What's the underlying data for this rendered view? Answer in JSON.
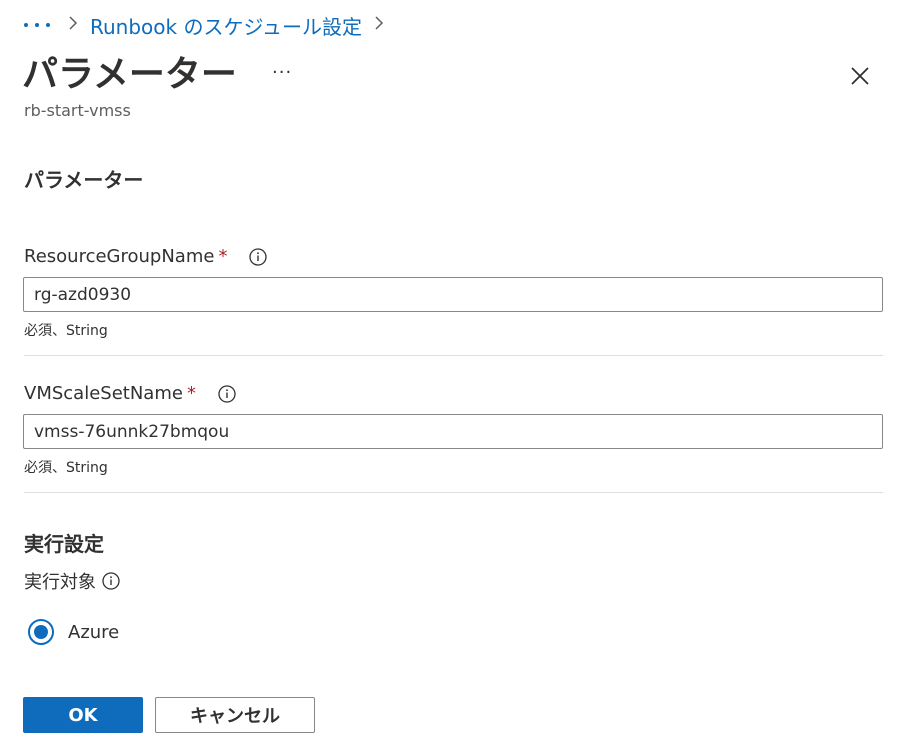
{
  "breadcrumb": {
    "items": [
      "Runbook のスケジュール設定"
    ]
  },
  "header": {
    "title": "パラメーター",
    "more_label": "···",
    "subtitle": "rb-start-vmss"
  },
  "parameters_section": {
    "heading": "パラメーター",
    "fields": [
      {
        "label": "ResourceGroupName",
        "required_marker": "*",
        "value": "rg-azd0930",
        "hint": "必須、String"
      },
      {
        "label": "VMScaleSetName",
        "required_marker": "*",
        "value": "vmss-76unnk27bmqou",
        "hint": "必須、String"
      }
    ]
  },
  "run_settings": {
    "heading": "実行設定",
    "run_on_label": "実行対象",
    "options": [
      {
        "label": "Azure",
        "selected": true
      }
    ]
  },
  "footer": {
    "ok_label": "OK",
    "cancel_label": "キャンセル"
  },
  "colors": {
    "accent": "#0f6cbd",
    "required": "#a4262c",
    "text": "#323130",
    "muted": "#605e5c",
    "border": "#8a8886",
    "divider": "#e1dfdd"
  },
  "icons": {
    "breadcrumb_more": "more-horizontal-icon",
    "chevron": "chevron-right-icon",
    "close": "close-icon",
    "info": "info-icon"
  }
}
